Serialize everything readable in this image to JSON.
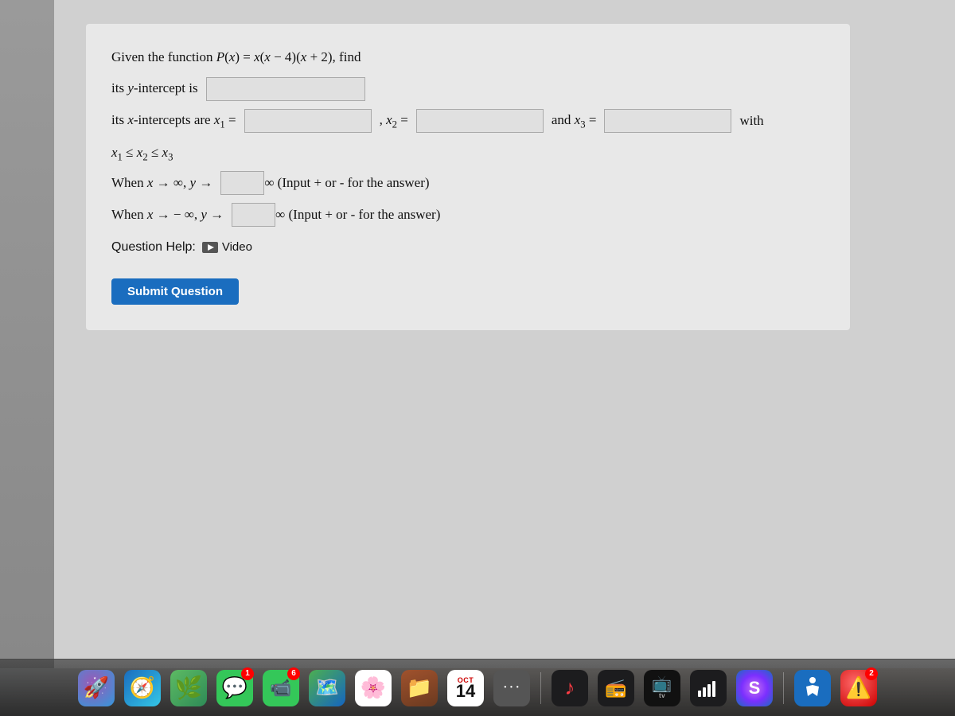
{
  "question": {
    "title": "Given the function P(x) = x(x − 4)(x + 2), find",
    "y_intercept_label": "its y-intercept is",
    "x_intercepts_label": "its x-intercepts are x",
    "x1_sub": "1",
    "x2_label": ", x",
    "x2_sub": "2",
    "x3_label": "and x",
    "x3_sub": "3",
    "x3_suffix": "with",
    "ordering_label": "x₁ ≤ x₂ ≤ x₃",
    "when_pos_inf_label": "When x → ∞, y →",
    "when_pos_inf_suffix": "∞ (Input + or - for the answer)",
    "when_neg_inf_label": "When x → − ∞, y →",
    "when_neg_inf_suffix": "∞ (Input + or - for the answer)",
    "help_label": "Question Help:",
    "video_label": "Video",
    "submit_label": "Submit Question"
  },
  "inputs": {
    "y_intercept_value": "",
    "x1_value": "",
    "x2_value": "",
    "x3_value": "",
    "pos_inf_sign": "",
    "neg_inf_sign": ""
  },
  "dock": {
    "items": [
      {
        "name": "rocket-icon",
        "label": "Launchpad",
        "color": "#555",
        "glyph": "🚀",
        "badge": null
      },
      {
        "name": "safari-icon",
        "label": "Safari",
        "color": "#1a6dbf",
        "glyph": "🧭",
        "badge": null
      },
      {
        "name": "photos-icon",
        "label": "Photos",
        "color": "#c00",
        "glyph": "🌅",
        "badge": null
      },
      {
        "name": "messages-icon",
        "label": "Messages",
        "color": "#34c759",
        "glyph": "💬",
        "badge": "1"
      },
      {
        "name": "facetime-icon",
        "label": "FaceTime",
        "color": "#34c759",
        "glyph": "📹",
        "badge": "6"
      },
      {
        "name": "maps-icon",
        "label": "Maps",
        "color": "#34a853",
        "glyph": "🗺️",
        "badge": null
      },
      {
        "name": "photos2-icon",
        "label": "Photos Library",
        "color": "#ffd700",
        "glyph": "🌸",
        "badge": null
      },
      {
        "name": "folder-icon",
        "label": "Folder",
        "color": "#8B5A2B",
        "glyph": "📁",
        "badge": null
      },
      {
        "name": "calendar-icon",
        "label": "Calendar",
        "color": "#fff",
        "glyph": "📅",
        "badge": null,
        "date": "14"
      },
      {
        "name": "dots-icon",
        "label": "More",
        "color": "#888",
        "glyph": "⋯",
        "badge": null
      },
      {
        "name": "music-icon",
        "label": "Music",
        "color": "#fc3c44",
        "glyph": "♪",
        "badge": null
      },
      {
        "name": "podcasts-icon",
        "label": "Podcasts",
        "color": "#b150e2",
        "glyph": "📻",
        "badge": null
      },
      {
        "name": "appletv-icon",
        "label": "Apple TV",
        "color": "#111",
        "glyph": "📺",
        "badge": null
      },
      {
        "name": "stocks-icon",
        "label": "Stocks",
        "color": "#1c1c1e",
        "glyph": "📈",
        "badge": null
      },
      {
        "name": "cell-icon",
        "label": "Signal",
        "color": "#888",
        "glyph": "📶",
        "badge": null
      },
      {
        "name": "siri-icon",
        "label": "Siri",
        "color": "#666",
        "glyph": "🎙️",
        "badge": null
      },
      {
        "name": "accessibility-icon",
        "label": "Accessibility",
        "color": "#1a6dbf",
        "glyph": "♿",
        "badge": null
      },
      {
        "name": "alert-icon",
        "label": "Alert",
        "color": "#ff3b30",
        "glyph": "❗",
        "badge": "2"
      }
    ]
  }
}
